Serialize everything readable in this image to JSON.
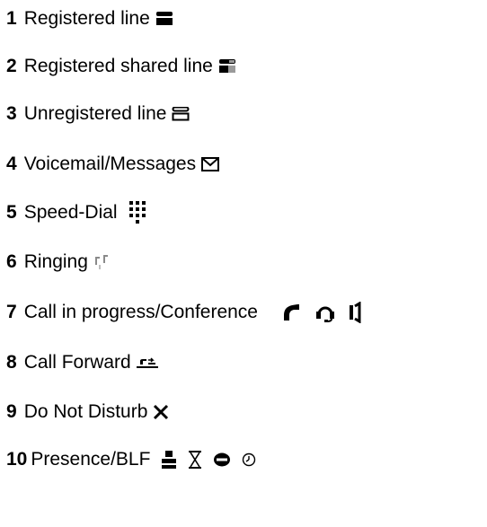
{
  "legend": {
    "items": [
      {
        "number": "1",
        "label": "Registered line",
        "icons": [
          "registered-line-phone-icon"
        ]
      },
      {
        "number": "2",
        "label": "Registered shared line",
        "icons": [
          "shared-line-phone-icon"
        ]
      },
      {
        "number": "3",
        "label": "Unregistered line",
        "icons": [
          "unregistered-line-phone-icon"
        ]
      },
      {
        "number": "4",
        "label": "Voicemail/Messages",
        "icons": [
          "envelope-icon"
        ]
      },
      {
        "number": "5",
        "label": "Speed-Dial",
        "icons": [
          "keypad-dots-icon"
        ]
      },
      {
        "number": "6",
        "label": "Ringing",
        "icons": [
          "ringing-notes-icon"
        ]
      },
      {
        "number": "7",
        "label": "Call in progress/Conference",
        "icons": [
          "handset-icon",
          "headset-icon",
          "speaker-icon"
        ]
      },
      {
        "number": "8",
        "label": "Call Forward",
        "icons": [
          "call-forward-icon"
        ]
      },
      {
        "number": "9",
        "label": "Do Not Disturb",
        "icons": [
          "do-not-disturb-x-icon"
        ]
      },
      {
        "number": "10",
        "label": "Presence/BLF",
        "icons": [
          "presence-person-icon",
          "hourglass-icon",
          "busy-minus-icon",
          "clock-icon"
        ]
      }
    ]
  }
}
